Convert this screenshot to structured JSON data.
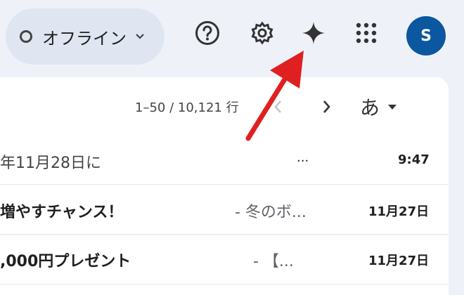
{
  "header": {
    "status_label": "オフライン",
    "avatar_letter": "S",
    "icons": [
      "help-icon",
      "settings-icon",
      "gemini-spark-icon",
      "apps-grid-icon"
    ]
  },
  "toolbar": {
    "pagination": "1–50 / 10,121 行",
    "language_button": "あ"
  },
  "rows": [
    {
      "subject": "年11月28日に",
      "snippet": "...",
      "date": "9:47"
    },
    {
      "subject": "増やすチャンス！",
      "snippet": "- 冬のボ...",
      "date": "11月27日"
    },
    {
      "subject": ",000円プレゼント",
      "snippet": "- 【...",
      "date": "11月27日"
    }
  ],
  "colors": {
    "background": "#eef2f8",
    "pill": "#dfe6f1",
    "avatar": "#0b57a0",
    "annotation_arrow": "#e02020"
  }
}
